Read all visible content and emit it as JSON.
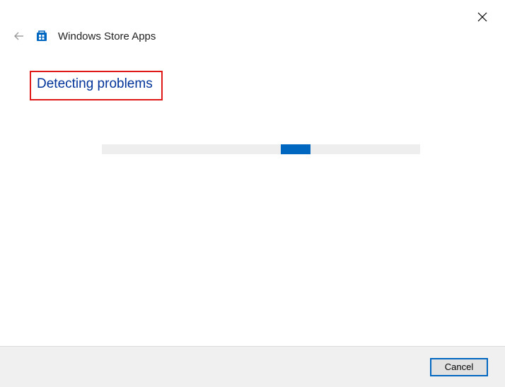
{
  "window": {
    "title": "Windows Store Apps"
  },
  "main": {
    "heading": "Detecting problems"
  },
  "footer": {
    "cancel_label": "Cancel"
  },
  "colors": {
    "accent": "#0067c0",
    "highlight_border": "#e11818",
    "heading_text": "#003399"
  }
}
